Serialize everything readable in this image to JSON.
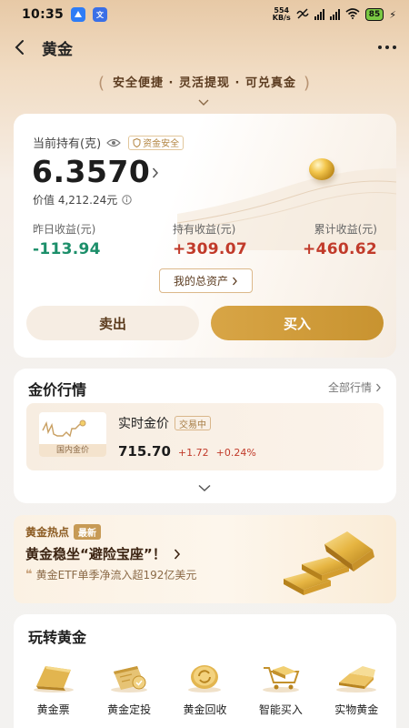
{
  "status_bar": {
    "time": "10:35",
    "net_speed_value": "554",
    "net_speed_unit": "KB/s",
    "battery": "85"
  },
  "header": {
    "title": "黄金"
  },
  "slogan": "安全便捷 · 灵活提现 · 可兑真金",
  "holding": {
    "label": "当前持有(克)",
    "safe_badge": "资金安全",
    "amount": "6.3570",
    "value_text": "价值 4,212.24元",
    "stats": [
      {
        "label": "昨日收益(元)",
        "value": "-113.94"
      },
      {
        "label": "持有收益(元)",
        "value": "+309.07"
      },
      {
        "label": "累计收益(元)",
        "value": "+460.62"
      }
    ],
    "total_assets_label": "我的总资产",
    "sell_label": "卖出",
    "buy_label": "买入"
  },
  "price": {
    "section_title": "金价行情",
    "all_label": "全部行情",
    "mini_chart_label": "国内金价",
    "realtime_label": "实时金价",
    "trading_badge": "交易中",
    "price": "715.70",
    "change": "+1.72",
    "change_pct": "+0.24%"
  },
  "hot": {
    "title": "黄金热点",
    "badge": "最新",
    "headline": "黄金稳坐“避险宝座”！",
    "sub": "黄金ETF单季净流入超192亿美元"
  },
  "play": {
    "title": "玩转黄金",
    "items": [
      {
        "label": "黄金票",
        "icon": "gold-ticket-icon"
      },
      {
        "label": "黄金定投",
        "icon": "gold-calendar-icon"
      },
      {
        "label": "黄金回收",
        "icon": "gold-recycle-icon"
      },
      {
        "label": "智能买入",
        "icon": "gold-cart-icon"
      },
      {
        "label": "实物黄金",
        "icon": "gold-bar-icon"
      }
    ]
  },
  "colors": {
    "gold": "#d0a044",
    "up": "#c13a2a",
    "down": "#1c8f6a"
  }
}
